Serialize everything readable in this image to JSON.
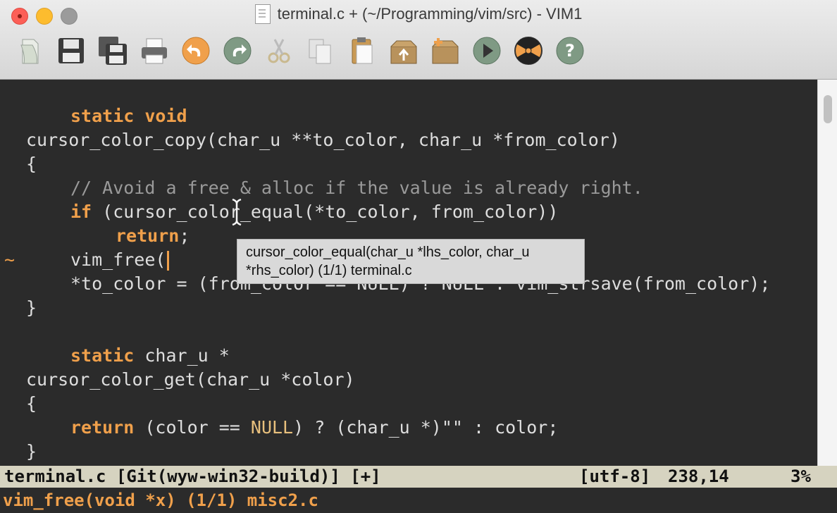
{
  "window": {
    "title": "terminal.c + (~/Programming/vim/src) - VIM1"
  },
  "toolbar": [
    {
      "name": "open-icon"
    },
    {
      "name": "save-icon"
    },
    {
      "name": "save-all-icon"
    },
    {
      "name": "print-icon"
    },
    {
      "name": "undo-icon"
    },
    {
      "name": "redo-icon"
    },
    {
      "name": "cut-icon"
    },
    {
      "name": "copy-icon"
    },
    {
      "name": "paste-icon"
    },
    {
      "name": "load-session-icon"
    },
    {
      "name": "save-session-icon"
    },
    {
      "name": "run-script-icon"
    },
    {
      "name": "make-icon"
    },
    {
      "name": "help-icon"
    }
  ],
  "editor": {
    "lines": {
      "l1": {
        "kw1": "static",
        "kw2": "void"
      },
      "l2": "cursor_color_copy(char_u **to_color, char_u *from_color)",
      "l3": "{",
      "l4": "// Avoid a free & alloc if the value is already right.",
      "l5": {
        "kw": "if",
        "rest": " (cursor_color_equal(*to_color, from_color))"
      },
      "l6": {
        "kw": "return",
        "rest": ";"
      },
      "l7": "vim_free(",
      "l8": "*to_color = (from_color == NULL) ? NULL : vim_strsave(from_color);",
      "l9": "}",
      "l11": {
        "kw": "static",
        "rest": " char_u *"
      },
      "l12": "cursor_color_get(char_u *color)",
      "l13": "{",
      "l14": {
        "kw": "return",
        "a": " (color == ",
        "null": "NULL",
        "b": ") ? (char_u *)\"\" : color;"
      },
      "l15": "}"
    },
    "tilde": "~"
  },
  "tooltip": {
    "line1": "cursor_color_equal(char_u *lhs_color, char_u",
    "line2": "*rhs_color) (1/1) terminal.c"
  },
  "statusline": {
    "left": "terminal.c [Git(wyw-win32-build)] [+]",
    "encoding": "[utf-8]",
    "position": "238,14",
    "percent": "3%"
  },
  "cmdline": {
    "text": "vim_free(void *x) (1/1) misc2.c"
  },
  "colors": {
    "background": "#2b2b2b",
    "keyword": "#f0a04b",
    "statusline_bg": "#d6d3c0"
  }
}
